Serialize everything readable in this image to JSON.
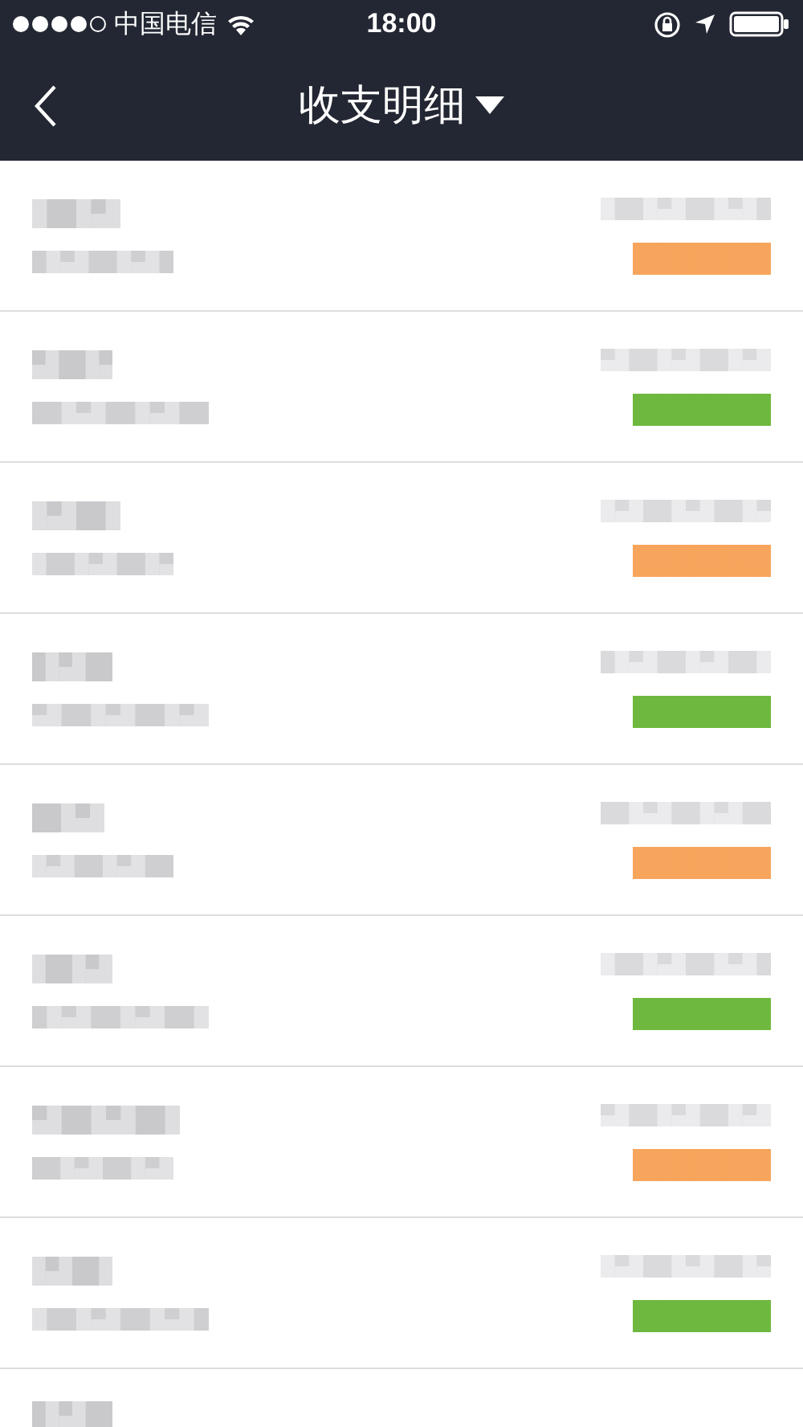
{
  "status_bar": {
    "carrier": "中国电信",
    "time": "18:00"
  },
  "nav": {
    "title": "收支明细"
  },
  "rows": [
    {
      "kind": "redacted",
      "color": "#f7a55c"
    },
    {
      "kind": "redacted",
      "color": "#6fb83f"
    },
    {
      "kind": "redacted",
      "color": "#f7a55c"
    },
    {
      "kind": "redacted",
      "color": "#6fb83f"
    },
    {
      "kind": "redacted",
      "color": "#f7a55c"
    },
    {
      "kind": "redacted",
      "color": "#6fb83f"
    },
    {
      "kind": "redacted",
      "color": "#f7a55c"
    },
    {
      "kind": "redacted",
      "color": "#6fb83f"
    },
    {
      "kind": "partial"
    }
  ]
}
